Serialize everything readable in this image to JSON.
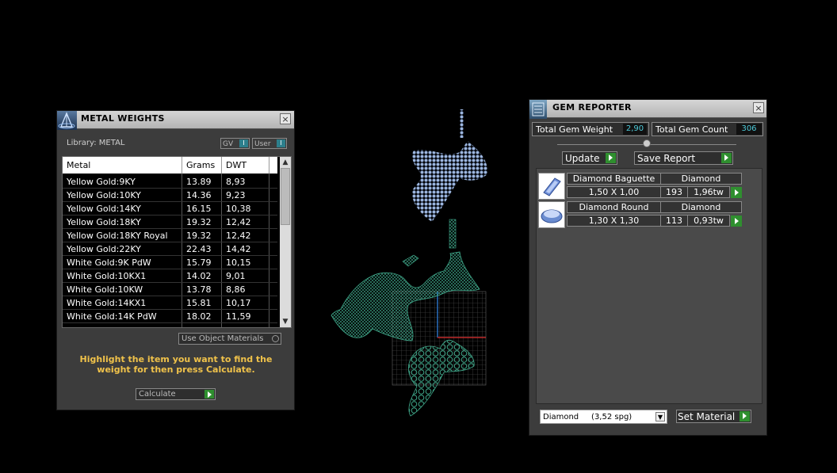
{
  "metal_panel": {
    "title": "METAL WEIGHTS",
    "close": "×",
    "library_label": "Library: METAL",
    "gv_label": "GV",
    "user_label": "User",
    "toggle_glyph": "I",
    "columns": {
      "metal": "Metal",
      "grams": "Grams",
      "dwt": "DWT"
    },
    "rows": [
      {
        "metal": "Yellow Gold:9KY",
        "grams": "13.89",
        "dwt": "8,93"
      },
      {
        "metal": "Yellow Gold:10KY",
        "grams": "14.36",
        "dwt": "9,23"
      },
      {
        "metal": "Yellow Gold:14KY",
        "grams": "16.15",
        "dwt": "10,38"
      },
      {
        "metal": "Yellow Gold:18KY",
        "grams": "19.32",
        "dwt": "12,42"
      },
      {
        "metal": "Yellow Gold:18KY Royal",
        "grams": "19.32",
        "dwt": "12,42"
      },
      {
        "metal": "Yellow Gold:22KY",
        "grams": "22.43",
        "dwt": "14,42"
      },
      {
        "metal": "White Gold:9K PdW",
        "grams": "15.79",
        "dwt": "10,15"
      },
      {
        "metal": "White Gold:10KX1",
        "grams": "14.02",
        "dwt": "9,01"
      },
      {
        "metal": "White Gold:10KW",
        "grams": "13.78",
        "dwt": "8,86"
      },
      {
        "metal": "White Gold:14KX1",
        "grams": "15.81",
        "dwt": "10,17"
      },
      {
        "metal": "White Gold:14K PdW",
        "grams": "18.02",
        "dwt": "11,59"
      }
    ],
    "use_object_materials": "Use Object Materials",
    "hint": "Highlight the item you want to find the weight for then press Calculate.",
    "calculate": "Calculate"
  },
  "gem_panel": {
    "title": "GEM REPORTER",
    "close": "×",
    "total_weight_label": "Total Gem Weight",
    "total_weight": "2,90",
    "total_count_label": "Total Gem Count",
    "total_count": "306",
    "update": "Update",
    "save_report": "Save Report",
    "items": [
      {
        "name": "Diamond Baguette",
        "material": "Diamond",
        "size": "1,50 X 1,00",
        "count": "193",
        "weight": "1,96tw",
        "icon": "baguette-gem-icon"
      },
      {
        "name": "Diamond Round",
        "material": "Diamond",
        "size": "1,30 X 1,30",
        "count": "113",
        "weight": "0,93tw",
        "icon": "round-gem-icon"
      }
    ],
    "material_select": "Diamond     (3,52 spg)",
    "set_material": "Set Material"
  },
  "colors": {
    "background": "#000000",
    "panel": "#3c3c3c",
    "hint_text": "#f0c24a",
    "value_text": "#4ec9d8",
    "play_green": "#2f8f2f",
    "gem_blue": "#9fb8e0",
    "mesh_green": "#3fa88a"
  }
}
